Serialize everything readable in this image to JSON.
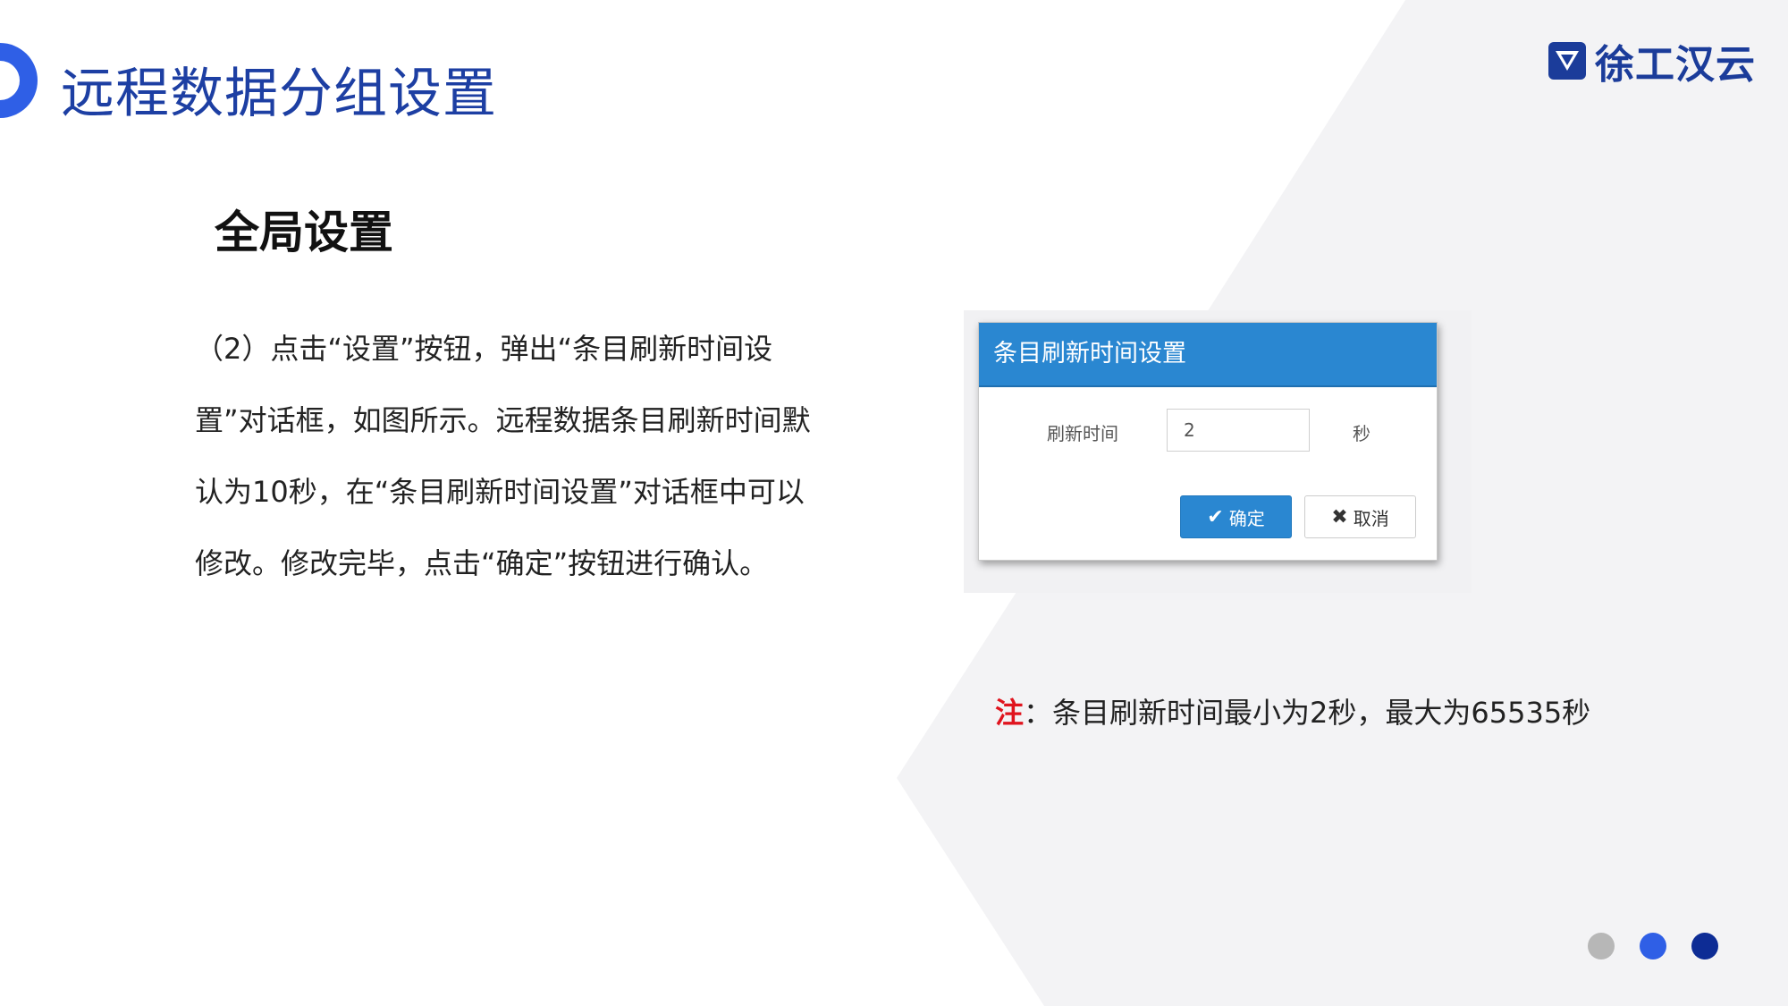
{
  "slide": {
    "title": "远程数据分组设置",
    "logo_text": "徐工汉云",
    "section_title": "全局设置",
    "paragraph_lines": [
      "（2）点击“设置”按钮，弹出“条目刷新时间设",
      "置”对话框，如图所示。远程数据条目刷新时间默",
      "认为10秒，在“条目刷新时间设置”对话框中可以",
      "修改。修改完毕，点击“确定”按钮进行确认。"
    ],
    "note_prefix": "注",
    "note_text": "：条目刷新时间最小为2秒，最大为65535秒"
  },
  "dialog": {
    "title": "条目刷新时间设置",
    "field_label": "刷新时间",
    "field_value": "2",
    "field_unit": "秒",
    "ok_label": "确定",
    "cancel_label": "取消"
  },
  "colors": {
    "title_blue": "#1d3fa3",
    "dialog_header": "#2a87d1",
    "note_red": "#e0141e",
    "dot_gray": "#b7b7b7",
    "dot_blue": "#2f5fe6",
    "dot_navy": "#0d2c95"
  }
}
